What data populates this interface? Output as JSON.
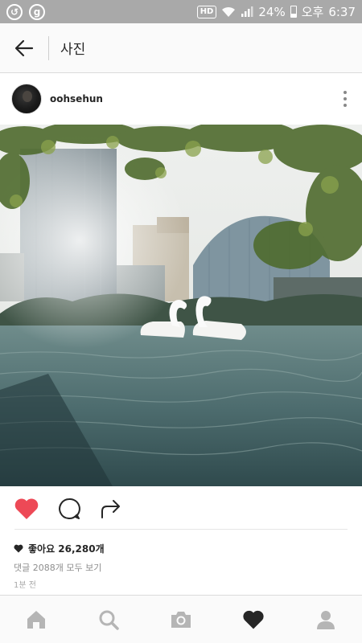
{
  "status_bar": {
    "icons": [
      "circle-arrow-icon",
      "g-circle-icon",
      "hd-badge",
      "wifi-icon",
      "signal-icon",
      "battery-icon"
    ],
    "left_glyphs": [
      "↺",
      "g"
    ],
    "hd": "HD",
    "battery": "24%",
    "ampm": "오후",
    "time": "6:37"
  },
  "header": {
    "back_icon": "arrow-left-icon",
    "title": "사진"
  },
  "post": {
    "username": "oohsehun",
    "more_icon": "more-vertical-icon",
    "photo_icon": "photo-swans-on-lake"
  },
  "actions": {
    "like_icon": "heart-filled-icon",
    "comment_icon": "comment-icon",
    "share_icon": "share-arrow-icon",
    "like_color": "#ed4956"
  },
  "likes": {
    "text": "좋아요 26,280개"
  },
  "comments": {
    "text": "댓글 2088개 모두 보기"
  },
  "timestamp": "1분 전",
  "bottom_nav": {
    "items": [
      {
        "icon": "home-icon",
        "active": false
      },
      {
        "icon": "search-icon",
        "active": false
      },
      {
        "icon": "camera-icon",
        "active": false
      },
      {
        "icon": "heart-icon",
        "active": true
      },
      {
        "icon": "profile-icon",
        "active": false
      }
    ]
  }
}
